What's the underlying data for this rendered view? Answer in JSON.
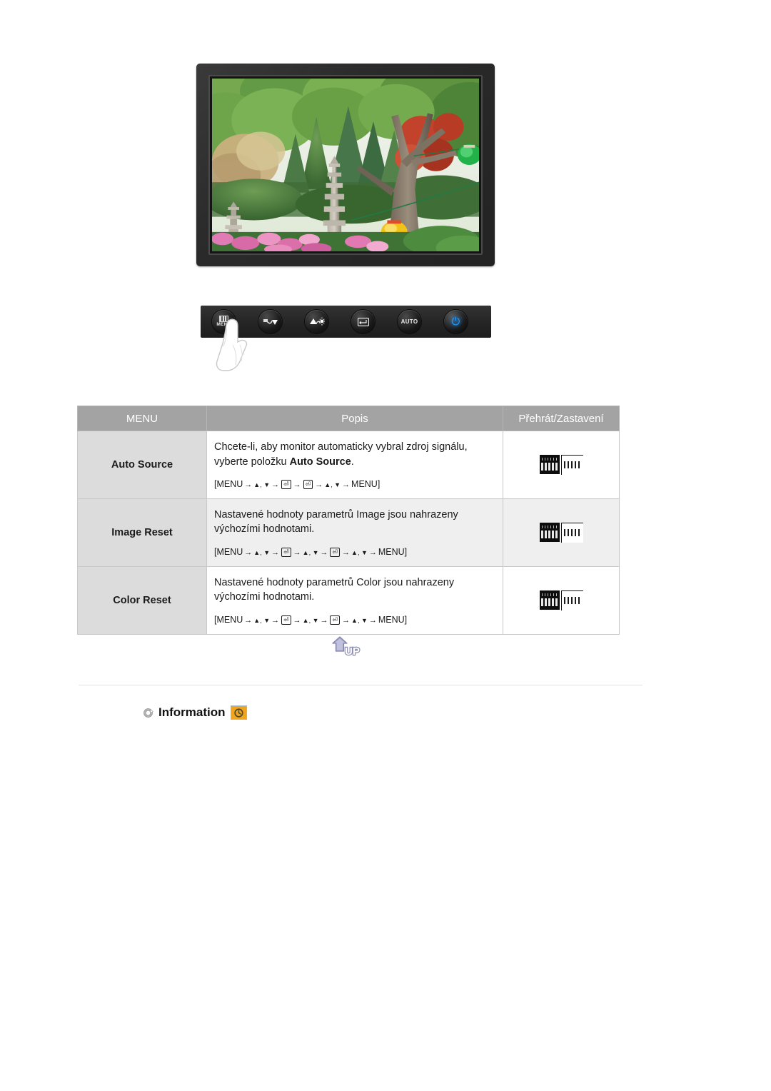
{
  "page": {
    "language": "cs",
    "background_color": "#ffffff"
  },
  "monitor_figure": {
    "name": "Samsung LCD monitor displaying a garden photo",
    "bezel_color": "#2b2b2b",
    "screen_scene": "Korean garden with stone pagoda, green trees, red and pink azaleas, and yellow/red/green paper lanterns"
  },
  "control_panel": {
    "buttons": [
      {
        "id": "menu",
        "icon": "menu-bars-icon",
        "caption": "MENU"
      },
      {
        "id": "down",
        "icon": "down-arrow-icon",
        "caption": ""
      },
      {
        "id": "brightness",
        "icon": "brightness-sun-icon",
        "caption": ""
      },
      {
        "id": "enter",
        "icon": "enter-key-icon",
        "caption": ""
      },
      {
        "id": "auto",
        "icon": "auto-text-icon",
        "caption": "AUTO"
      },
      {
        "id": "power",
        "icon": "power-icon",
        "caption": ""
      }
    ],
    "pointer": "hand-pointing-at-menu-button",
    "power_led_color": "#1e9bff"
  },
  "table": {
    "header_bg": "#a3a3a3",
    "headers": {
      "menu": "MENU",
      "description": "Popis",
      "play_stop": "Přehrát/Zastavení"
    },
    "rows": [
      {
        "menu": "Auto Source",
        "description_line1": "Chcete-li, aby monitor automaticky vybral zdroj signálu,",
        "description_line2_prefix": "vyberte položku ",
        "description_line2_bold": "Auto Source",
        "description_line2_suffix": ".",
        "path_open": "[MENU",
        "path_close": "MENU]",
        "path_steps": [
          "▲, ▼",
          "ENTER",
          "ENTER",
          "▲, ▼"
        ],
        "thumb": "osd-menu-thumbnail"
      },
      {
        "menu": "Image Reset",
        "description_line1": "Nastavené hodnoty parametrů Image jsou nahrazeny",
        "description_line2_prefix": "výchozími hodnotami.",
        "description_line2_bold": "",
        "description_line2_suffix": "",
        "path_open": "[MENU",
        "path_close": "MENU]",
        "path_steps": [
          "▲, ▼",
          "ENTER",
          "▲, ▼",
          "ENTER",
          "▲, ▼"
        ],
        "thumb": "osd-menu-thumbnail"
      },
      {
        "menu": "Color Reset",
        "description_line1": "Nastavené hodnoty parametrů Color jsou nahrazeny",
        "description_line2_prefix": "výchozími hodnotami.",
        "description_line2_bold": "",
        "description_line2_suffix": "",
        "path_open": "[MENU",
        "path_close": "MENU]",
        "path_steps": [
          "▲, ▼",
          "ENTER",
          "▲, ▼",
          "ENTER",
          "▲, ▼"
        ],
        "thumb": "osd-menu-thumbnail"
      }
    ]
  },
  "up_button": {
    "label": "UP",
    "arrow_color": "#9fa0c8",
    "icon": "up-arrow-icon"
  },
  "information_section": {
    "bullet_icon": "circle-arrow-bullet-icon",
    "title": "Information",
    "badge_icon": "orange-clock-badge-icon",
    "badge_color": "#f0a41e"
  }
}
